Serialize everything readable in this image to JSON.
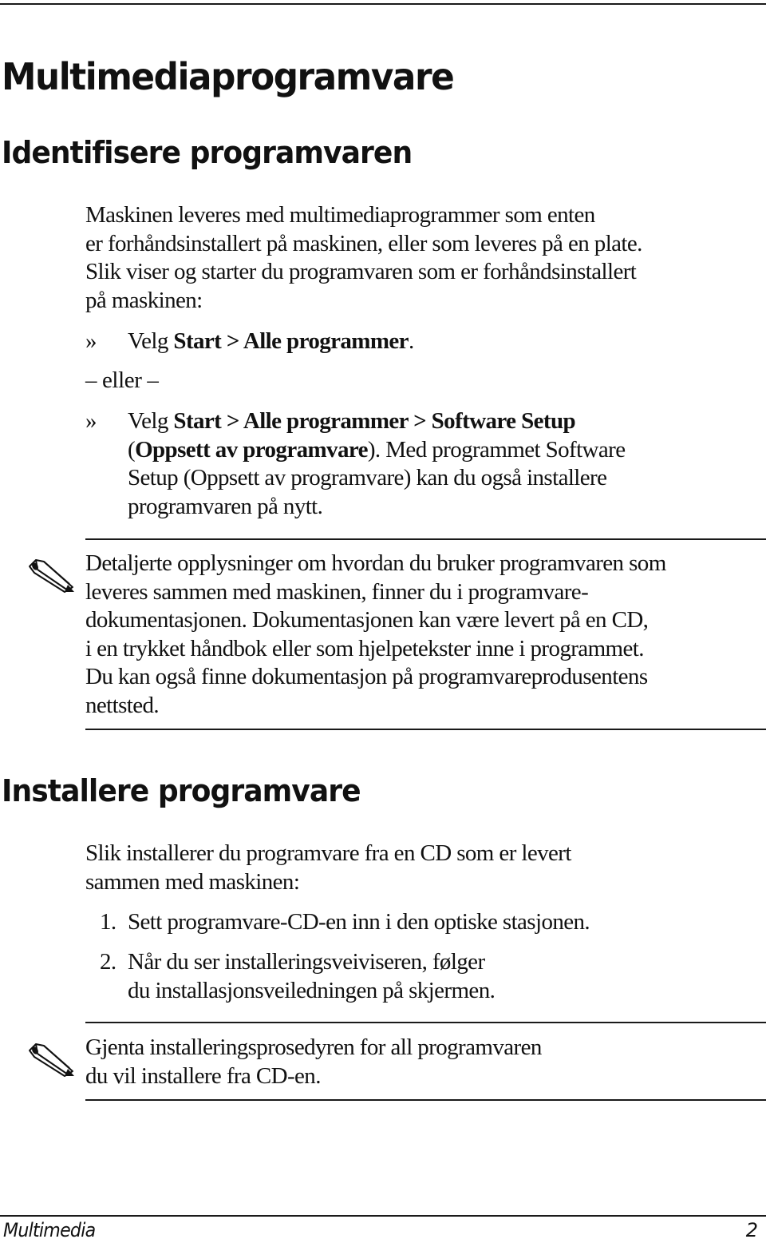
{
  "page": {
    "title": "Multimediaprogramvare",
    "sections": {
      "identify": {
        "heading": "Identifisere programvaren",
        "intro_lines": [
          "Maskinen leveres med multimediaprogrammer som enten",
          "er forhåndsinstallert på maskinen, eller som leveres på en plate.",
          "Slik viser og starter du programvaren som er forhåndsinstallert",
          "på maskinen:"
        ],
        "bullet_marker": "»",
        "bullet_1": {
          "prefix": "Velg ",
          "bold": "Start > Alle programmer",
          "suffix": "."
        },
        "or_text": "– eller –",
        "bullet_2": {
          "line1_prefix": "Velg ",
          "line1_bold": "Start > Alle programmer > Software Setup",
          "line2_open": "(",
          "line2_bold": "Oppsett av programvare",
          "line2_rest": "). Med programmet Software",
          "line3": "Setup (Oppsett av programvare) kan du også installere",
          "line4": "programvaren på nytt."
        },
        "note": {
          "icon": "pencil-note-icon",
          "lines": [
            "Detaljerte opplysninger om hvordan du bruker programvaren som",
            "leveres sammen med maskinen, finner du i programvare-",
            "dokumentasjonen. Dokumentasjonen kan være levert på en CD,",
            "i en trykket håndbok eller som hjelpetekster inne i programmet.",
            "Du kan også finne dokumentasjon på programvareprodusentens",
            "nettsted."
          ]
        }
      },
      "install": {
        "heading": "Installere programvare",
        "intro_lines": [
          "Slik installerer du programvare fra en CD som er levert",
          "sammen med maskinen:"
        ],
        "steps": [
          {
            "num": "1.",
            "lines": [
              "Sett programvare-CD-en inn i den optiske stasjonen."
            ]
          },
          {
            "num": "2.",
            "lines": [
              "Når du ser installeringsveiviseren, følger",
              "du installasjonsveiledningen på skjermen."
            ]
          }
        ],
        "note": {
          "icon": "pencil-note-icon",
          "lines": [
            "Gjenta installeringsprosedyren for all programvaren",
            "du vil installere fra CD-en."
          ]
        }
      }
    },
    "footer": {
      "chapter": "Multimedia",
      "page_number": "2"
    }
  }
}
